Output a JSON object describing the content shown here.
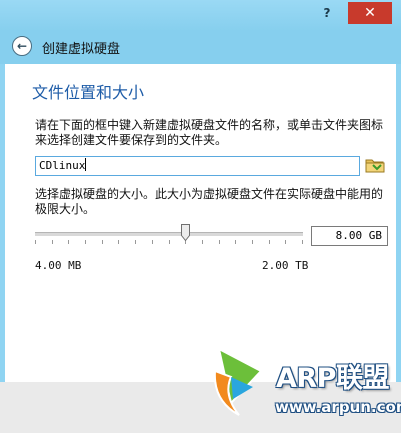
{
  "window": {
    "help_label": "?",
    "minimize_label": "—",
    "close_label": "✕"
  },
  "header": {
    "title": "创建虚拟硬盘",
    "back_icon": "back-arrow-icon"
  },
  "main": {
    "section_title": "文件位置和大小",
    "location_description": "请在下面的框中键入新建虚拟硬盘文件的名称，或单击文件夹图标来选择创建文件要保存到的文件夹。",
    "file_name_value": "CDlinux",
    "folder_icon": "folder-icon",
    "size_description": "选择虚拟硬盘的大小。此大小为虚拟硬盘文件在实际硬盘中能用的极限大小。",
    "size_value": "8.00 GB",
    "slider_fraction": 0.56,
    "range_min": "4.00 MB",
    "range_max": "2.00 TB"
  },
  "watermark": {
    "brand_text": "ARP联盟",
    "url_text": "www.arpun.com",
    "colors": {
      "green": "#6cbf3a",
      "orange": "#f28a1e",
      "blue": "#1f4f82",
      "cyan": "#2aa6de"
    }
  }
}
